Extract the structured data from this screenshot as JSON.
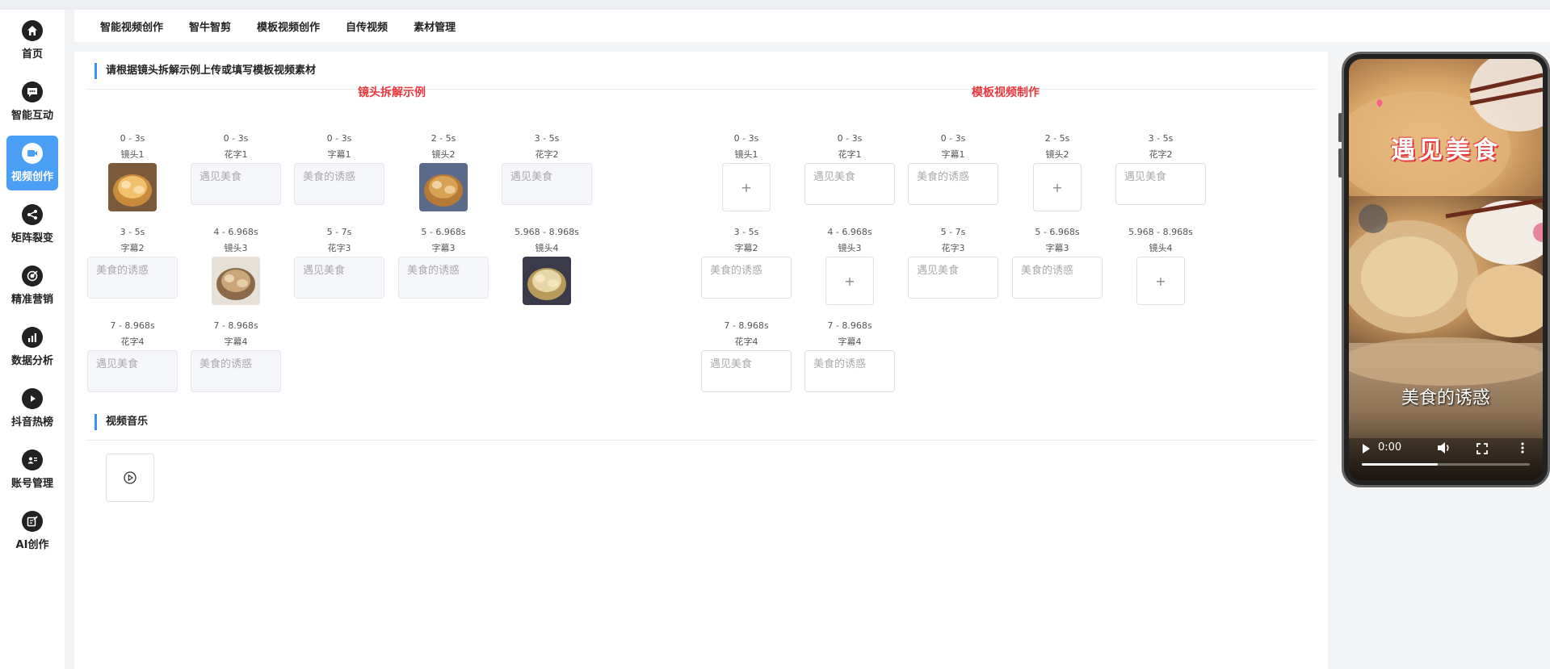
{
  "sidebar": {
    "items": [
      {
        "label": "首页",
        "icon": "home-icon",
        "active": false
      },
      {
        "label": "智能互动",
        "icon": "chat-icon",
        "active": false
      },
      {
        "label": "视频创作",
        "icon": "video-icon",
        "active": true
      },
      {
        "label": "矩阵裂变",
        "icon": "share-icon",
        "active": false
      },
      {
        "label": "精准营销",
        "icon": "target-icon",
        "active": false
      },
      {
        "label": "数据分析",
        "icon": "chart-icon",
        "active": false
      },
      {
        "label": "抖音热榜",
        "icon": "play-icon",
        "active": false
      },
      {
        "label": "账号管理",
        "icon": "id-card-icon",
        "active": false
      },
      {
        "label": "AI创作",
        "icon": "edit-icon",
        "active": false
      }
    ]
  },
  "tabs": [
    "智能视频创作",
    "智牛智剪",
    "模板视频创作",
    "自传视频",
    "素材管理"
  ],
  "section1": {
    "title": "请根据镜头拆解示例上传或填写模板视频素材"
  },
  "example": {
    "title": "镜头拆解示例",
    "rows": [
      [
        {
          "time": "0 - 3s",
          "name": "镜头1",
          "kind": "image"
        },
        {
          "time": "0 - 3s",
          "name": "花字1",
          "kind": "text",
          "value": "遇见美食"
        },
        {
          "time": "0 - 3s",
          "name": "字幕1",
          "kind": "text",
          "value": "美食的诱惑"
        },
        {
          "time": "2 - 5s",
          "name": "镜头2",
          "kind": "image"
        },
        {
          "time": "3 - 5s",
          "name": "花字2",
          "kind": "text",
          "value": "遇见美食"
        }
      ],
      [
        {
          "time": "3 - 5s",
          "name": "字幕2",
          "kind": "text",
          "value": "美食的诱惑"
        },
        {
          "time": "4 - 6.968s",
          "name": "镜头3",
          "kind": "image"
        },
        {
          "time": "5 - 7s",
          "name": "花字3",
          "kind": "text",
          "value": "遇见美食"
        },
        {
          "time": "5 - 6.968s",
          "name": "字幕3",
          "kind": "text",
          "value": "美食的诱惑"
        },
        {
          "time": "5.968 - 8.968s",
          "name": "镜头4",
          "kind": "image"
        }
      ],
      [
        {
          "time": "7 - 8.968s",
          "name": "花字4",
          "kind": "text",
          "value": "遇见美食"
        },
        {
          "time": "7 - 8.968s",
          "name": "字幕4",
          "kind": "text",
          "value": "美食的诱惑"
        }
      ]
    ]
  },
  "template": {
    "title": "模板视频制作",
    "upload_symbol": "+",
    "rows": [
      [
        {
          "time": "0 - 3s",
          "name": "镜头1",
          "kind": "upload"
        },
        {
          "time": "0 - 3s",
          "name": "花字1",
          "kind": "text",
          "placeholder": "遇见美食"
        },
        {
          "time": "0 - 3s",
          "name": "字幕1",
          "kind": "text",
          "placeholder": "美食的诱惑"
        },
        {
          "time": "2 - 5s",
          "name": "镜头2",
          "kind": "upload"
        },
        {
          "time": "3 - 5s",
          "name": "花字2",
          "kind": "text",
          "placeholder": "遇见美食"
        }
      ],
      [
        {
          "time": "3 - 5s",
          "name": "字幕2",
          "kind": "text",
          "placeholder": "美食的诱惑"
        },
        {
          "time": "4 - 6.968s",
          "name": "镜头3",
          "kind": "upload"
        },
        {
          "time": "5 - 7s",
          "name": "花字3",
          "kind": "text",
          "placeholder": "遇见美食"
        },
        {
          "time": "5 - 6.968s",
          "name": "字幕3",
          "kind": "text",
          "placeholder": "美食的诱惑"
        },
        {
          "time": "5.968 - 8.968s",
          "name": "镜头4",
          "kind": "upload"
        }
      ],
      [
        {
          "time": "7 - 8.968s",
          "name": "花字4",
          "kind": "text",
          "placeholder": "遇见美食"
        },
        {
          "time": "7 - 8.968s",
          "name": "字幕4",
          "kind": "text",
          "placeholder": "美食的诱惑"
        }
      ]
    ]
  },
  "section2": {
    "title": "视频音乐"
  },
  "preview": {
    "overlay_title": "遇见美食",
    "caption": "美食的诱惑",
    "time": "0:00",
    "progress": 0.45
  },
  "colors": {
    "accent": "#4a9ff5",
    "red": "#e8383d",
    "section_bar": "#3b8ff0"
  }
}
